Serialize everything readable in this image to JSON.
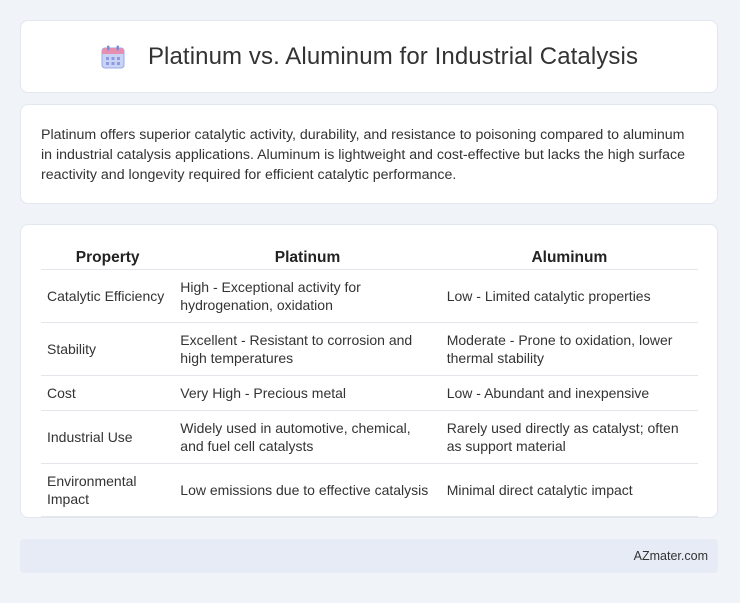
{
  "header": {
    "title": "Platinum vs. Aluminum for Industrial Catalysis",
    "icon": "calendar-icon"
  },
  "intro": {
    "text": "Platinum offers superior catalytic activity, durability, and resistance to poisoning compared to aluminum in industrial catalysis applications. Aluminum is lightweight and cost-effective but lacks the high surface reactivity and longevity required for efficient catalytic performance."
  },
  "table": {
    "headers": [
      "Property",
      "Platinum",
      "Aluminum"
    ],
    "rows": [
      [
        "Catalytic Efficiency",
        "High - Exceptional activity for hydrogenation, oxidation",
        "Low - Limited catalytic properties"
      ],
      [
        "Stability",
        "Excellent - Resistant to corrosion and high temperatures",
        "Moderate - Prone to oxidation, lower thermal stability"
      ],
      [
        "Cost",
        "Very High - Precious metal",
        "Low - Abundant and inexpensive"
      ],
      [
        "Industrial Use",
        "Widely used in automotive, chemical, and fuel cell catalysts",
        "Rarely used directly as catalyst; often as support material"
      ],
      [
        "Environmental Impact",
        "Low emissions due to effective catalysis",
        "Minimal direct catalytic impact"
      ]
    ]
  },
  "footer": {
    "site": "AZmater.com"
  },
  "colors": {
    "background": "#f0f3f8",
    "card": "#ffffff",
    "footer": "#e6ebf6",
    "icon_accent": "#7b8cd9"
  }
}
